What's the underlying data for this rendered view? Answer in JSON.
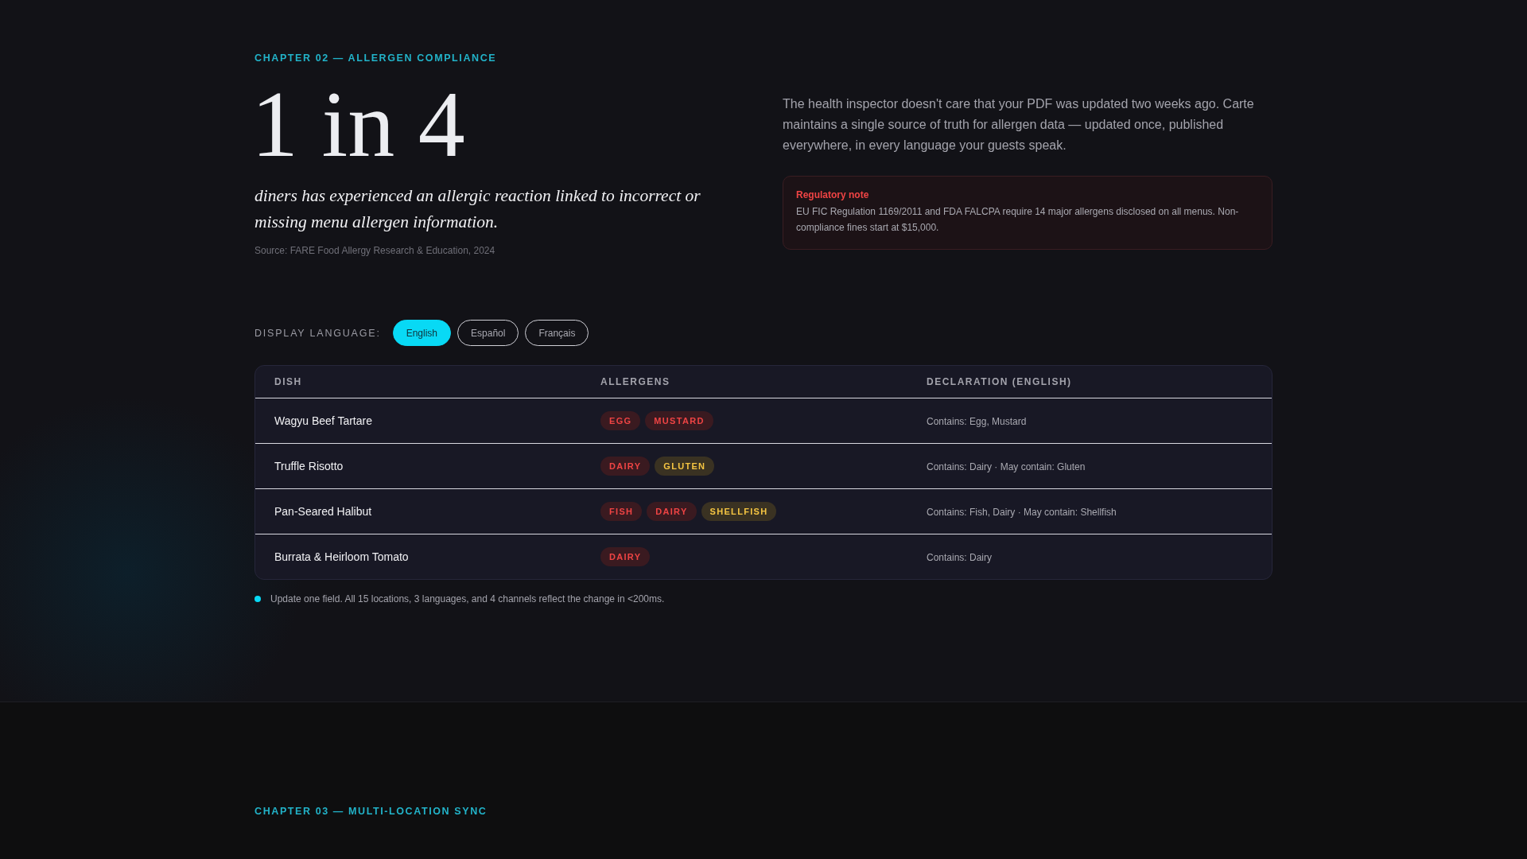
{
  "chapter": "CHAPTER 02 — ALLERGEN COMPLIANCE",
  "stat": {
    "value": "1 in 4",
    "caption": "diners has experienced an allergic reaction linked to incorrect or missing menu allergen information.",
    "source": "Source: FARE Food Allergy Research & Education, 2024"
  },
  "intro": "The health inspector doesn't care that your PDF was updated two weeks ago. Carte maintains a single source of truth for allergen data — updated once, published everywhere, in every language your guests speak.",
  "note": {
    "title": "Regulatory note",
    "text": "EU FIC Regulation 1169/2011 and FDA FALCPA require 14 major allergens disclosed on all menus. Non-compliance fines start at $15,000."
  },
  "language": {
    "label": "DISPLAY LANGUAGE:",
    "options": [
      {
        "label": "English",
        "selected": true
      },
      {
        "label": "Español",
        "selected": false
      },
      {
        "label": "Français",
        "selected": false
      }
    ]
  },
  "table": {
    "columns": [
      "DISH",
      "ALLERGENS",
      "DECLARATION (ENGLISH)"
    ],
    "rows": [
      {
        "dish": "Wagyu Beef Tartare",
        "allergens": [
          {
            "label": "EGG",
            "kind": "contains"
          },
          {
            "label": "MUSTARD",
            "kind": "contains"
          }
        ],
        "declaration": "Contains: Egg, Mustard"
      },
      {
        "dish": "Truffle Risotto",
        "allergens": [
          {
            "label": "DAIRY",
            "kind": "contains"
          },
          {
            "label": "GLUTEN",
            "kind": "may"
          }
        ],
        "declaration": "Contains: Dairy · May contain: Gluten"
      },
      {
        "dish": "Pan-Seared Halibut",
        "allergens": [
          {
            "label": "FISH",
            "kind": "contains"
          },
          {
            "label": "DAIRY",
            "kind": "contains"
          },
          {
            "label": "SHELLFISH",
            "kind": "may"
          }
        ],
        "declaration": "Contains: Fish, Dairy · May contain: Shellfish"
      },
      {
        "dish": "Burrata & Heirloom Tomato",
        "allergens": [
          {
            "label": "DAIRY",
            "kind": "contains"
          }
        ],
        "declaration": "Contains: Dairy"
      }
    ]
  },
  "footnote": "Update one field. All 15 locations, 3 languages, and 4 channels reflect the change in <200ms.",
  "next_chapter": "CHAPTER 03 — MULTI-LOCATION SYNC"
}
